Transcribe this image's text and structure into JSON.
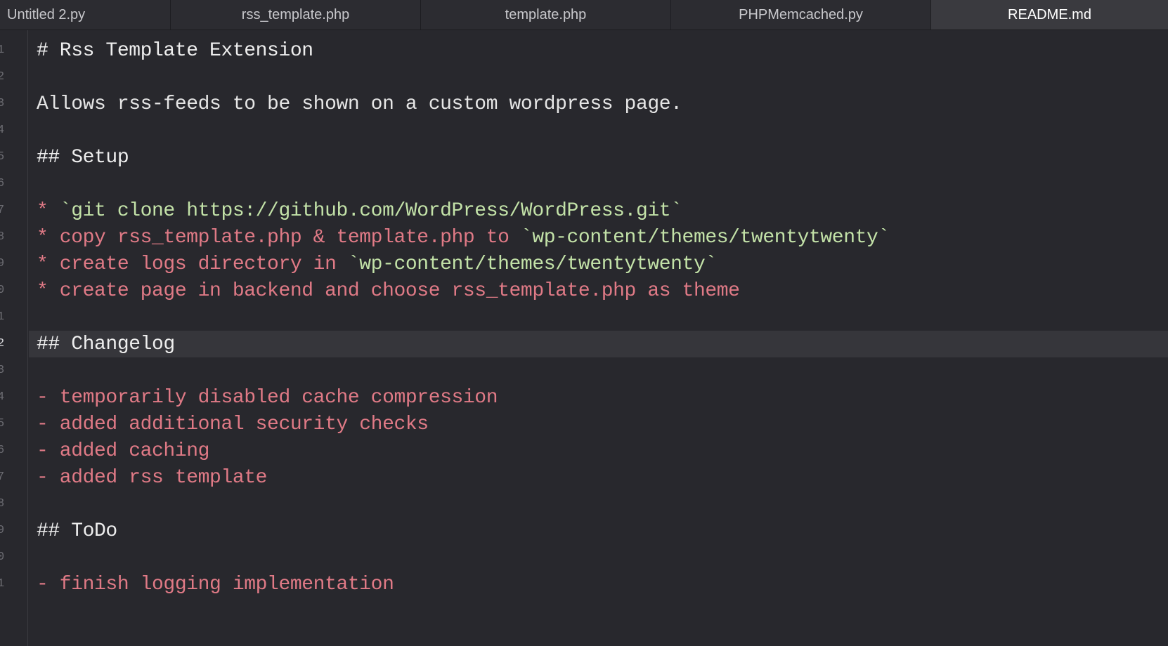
{
  "tabs": [
    {
      "label": "Untitled 2.py",
      "active": false
    },
    {
      "label": "rss_template.php",
      "active": false
    },
    {
      "label": "template.php",
      "active": false
    },
    {
      "label": "PHPMemcached.py",
      "active": false
    },
    {
      "label": "README.md",
      "active": true
    }
  ],
  "gutter": {
    "line_numbers": [
      "1",
      "2",
      "3",
      "4",
      "5",
      "6",
      "7",
      "8",
      "9",
      "0",
      "1",
      "2",
      "3",
      "4",
      "5",
      "6",
      "7",
      "8",
      "9",
      "0",
      "1"
    ],
    "current_line_index": 11
  },
  "editor": {
    "lines": {
      "l1": "# Rss Template Extension",
      "l3": "Allows rss-feeds to be shown on a custom wordpress page.",
      "l5": "## Setup",
      "l7_bullet": "* ",
      "l7_code": "`git clone https://github.com/WordPress/WordPress.git`",
      "l8_text": "* copy rss_template.php & template.php to ",
      "l8_code": "`wp-content/themes/twentytwenty`",
      "l9_text": "* create logs directory in ",
      "l9_code": "`wp-content/themes/twentytwenty`",
      "l10": "* create page in backend and choose rss_template.php as theme",
      "l12": "## Changelog",
      "l14": "- temporarily disabled cache compression",
      "l15": "- added additional security checks",
      "l16": "- added caching",
      "l17": "- added rss template",
      "l19": "## ToDo",
      "l21": "- finish logging implementation"
    }
  },
  "colors": {
    "background": "#28282d",
    "tabbar": "#2c2c31",
    "active_tab": "#3a3a3f",
    "current_line": "#36363b",
    "list_text": "#e07a86",
    "code_text": "#c3e2a8",
    "plain_text": "#e6e6e6"
  }
}
